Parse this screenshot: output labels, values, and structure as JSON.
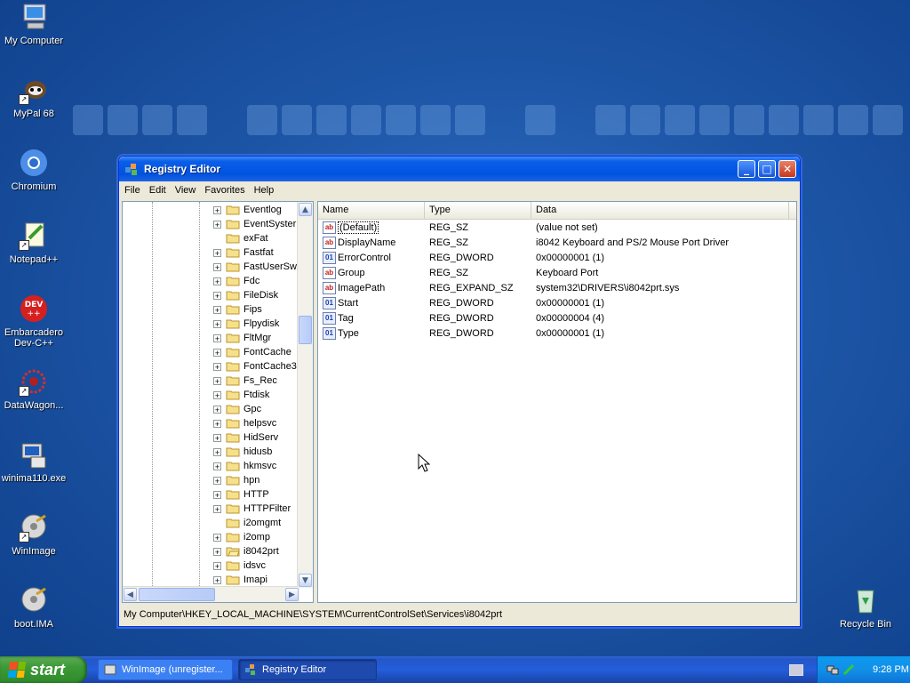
{
  "desktop": {
    "icons": [
      {
        "name": "my-computer-icon",
        "label": "My Computer"
      },
      {
        "name": "mypal-icon",
        "label": "MyPal 68"
      },
      {
        "name": "chromium-icon",
        "label": "Chromium"
      },
      {
        "name": "notepadpp-icon",
        "label": "Notepad++"
      },
      {
        "name": "devcpp-icon",
        "label": "Embarcadero Dev-C++"
      },
      {
        "name": "datawagon-icon",
        "label": "DataWagon..."
      },
      {
        "name": "winima-icon",
        "label": "winima110.exe"
      },
      {
        "name": "winimage-icon",
        "label": "WinImage"
      },
      {
        "name": "bootima-icon",
        "label": "boot.IMA"
      }
    ],
    "recycle_bin": "Recycle Bin"
  },
  "window": {
    "title": "Registry Editor",
    "menu": [
      "File",
      "Edit",
      "View",
      "Favorites",
      "Help"
    ],
    "tree": [
      {
        "label": "Eventlog",
        "expandable": true
      },
      {
        "label": "EventSyster",
        "expandable": true
      },
      {
        "label": "exFat",
        "expandable": false
      },
      {
        "label": "Fastfat",
        "expandable": true
      },
      {
        "label": "FastUserSw",
        "expandable": true
      },
      {
        "label": "Fdc",
        "expandable": true
      },
      {
        "label": "FileDisk",
        "expandable": true
      },
      {
        "label": "Fips",
        "expandable": true
      },
      {
        "label": "Flpydisk",
        "expandable": true
      },
      {
        "label": "FltMgr",
        "expandable": true
      },
      {
        "label": "FontCache",
        "expandable": true
      },
      {
        "label": "FontCache3",
        "expandable": true
      },
      {
        "label": "Fs_Rec",
        "expandable": true
      },
      {
        "label": "Ftdisk",
        "expandable": true
      },
      {
        "label": "Gpc",
        "expandable": true
      },
      {
        "label": "helpsvc",
        "expandable": true
      },
      {
        "label": "HidServ",
        "expandable": true
      },
      {
        "label": "hidusb",
        "expandable": true
      },
      {
        "label": "hkmsvc",
        "expandable": true
      },
      {
        "label": "hpn",
        "expandable": true
      },
      {
        "label": "HTTP",
        "expandable": true
      },
      {
        "label": "HTTPFilter",
        "expandable": true
      },
      {
        "label": "i2omgmt",
        "expandable": false
      },
      {
        "label": "i2omp",
        "expandable": true
      },
      {
        "label": "i8042prt",
        "expandable": true,
        "open": true
      },
      {
        "label": "idsvc",
        "expandable": true
      },
      {
        "label": "Imapi",
        "expandable": true
      }
    ],
    "columns": [
      "Name",
      "Type",
      "Data"
    ],
    "values": [
      {
        "name": "(Default)",
        "type": "REG_SZ",
        "data": "(value not set)",
        "icon": "ab"
      },
      {
        "name": "DisplayName",
        "type": "REG_SZ",
        "data": "i8042 Keyboard and PS/2 Mouse Port Driver",
        "icon": "ab"
      },
      {
        "name": "ErrorControl",
        "type": "REG_DWORD",
        "data": "0x00000001 (1)",
        "icon": "dw"
      },
      {
        "name": "Group",
        "type": "REG_SZ",
        "data": "Keyboard Port",
        "icon": "ab"
      },
      {
        "name": "ImagePath",
        "type": "REG_EXPAND_SZ",
        "data": "system32\\DRIVERS\\i8042prt.sys",
        "icon": "ab"
      },
      {
        "name": "Start",
        "type": "REG_DWORD",
        "data": "0x00000001 (1)",
        "icon": "dw"
      },
      {
        "name": "Tag",
        "type": "REG_DWORD",
        "data": "0x00000004 (4)",
        "icon": "dw"
      },
      {
        "name": "Type",
        "type": "REG_DWORD",
        "data": "0x00000001 (1)",
        "icon": "dw"
      }
    ],
    "status_path": "My Computer\\HKEY_LOCAL_MACHINE\\SYSTEM\\CurrentControlSet\\Services\\i8042prt"
  },
  "taskbar": {
    "start_label": "start",
    "tasks": [
      {
        "label": "WinImage (unregister...",
        "active": false
      },
      {
        "label": "Registry Editor",
        "active": true
      }
    ],
    "clock": "9:28 PM"
  }
}
